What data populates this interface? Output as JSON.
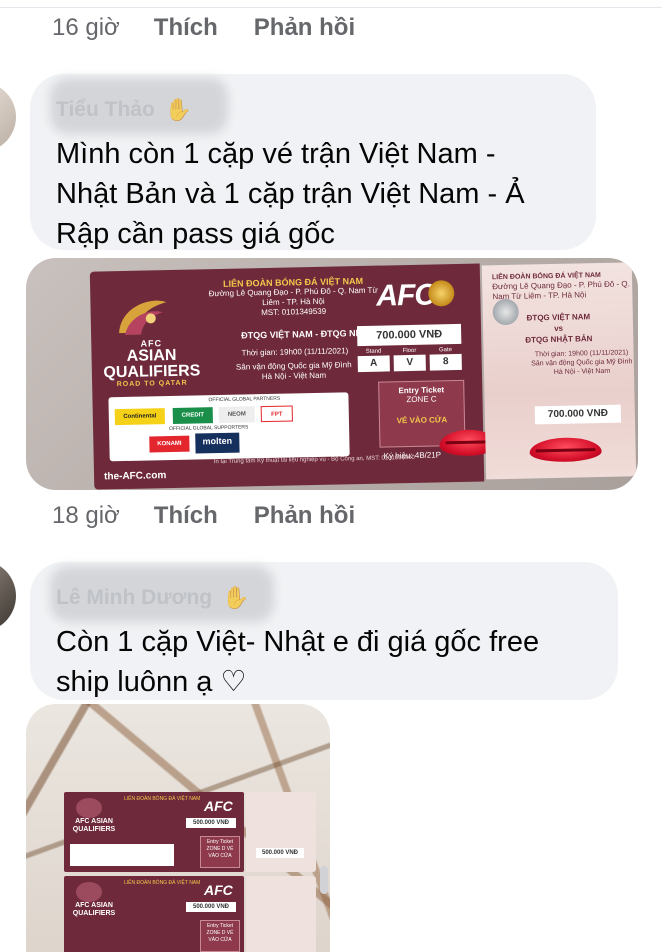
{
  "comment0": {
    "time": "16 giờ",
    "like": "Thích",
    "reply": "Phản hồi"
  },
  "comment1": {
    "author": "Tiểu Thảo",
    "text_line1": "Mình còn 1 cặp vé trận Việt Nam -",
    "text_line2": "Nhật Bản và 1 cặp trận Việt Nam - Ả",
    "text_line3": "Rập cần pass giá gốc",
    "wave_icon": "wave-hand-icon",
    "time": "18 giờ",
    "like": "Thích",
    "reply": "Phản hồi",
    "ticket": {
      "federation": "LIÊN ĐOÀN BÓNG ĐÁ VIỆT NAM",
      "address": "Đường Lê Quang Đạo - P. Phú Đô - Q. Nam Từ Liêm - TP. Hà Nội",
      "tax_code": "MST: 0101349539",
      "brand": "AFC",
      "afc_small": "AFC",
      "qualifiers_line1": "ASIAN",
      "qualifiers_line2": "QUALIFIERS",
      "road": "ROAD TO QATAR",
      "match": "ĐTQG VIỆT NAM - ĐTQG NHẬT BẢN",
      "date": "Thời gian: 19h00 (11/11/2021)",
      "venue": "Sân vận động Quốc gia Mỹ Đình Hà Nội - Việt Nam",
      "price": "700.000 VNĐ",
      "stand_label": "Stand",
      "floor_label": "Floor",
      "gate_label": "Gate",
      "stand": "A",
      "floor": "V",
      "gate": "8",
      "partners_label": "OFFICIAL GLOBAL PARTNERS",
      "supporters_label": "OFFICIAL GLOBAL SUPPORTERS",
      "sponsor1": "Continental",
      "sponsor2": "CREDIT SAISON",
      "sponsor3": "NEOM",
      "sponsor4": "FPT",
      "sponsor5": "KONAMI",
      "sponsor6": "molten",
      "entry": "Entry Ticket",
      "zone": "ZONE C",
      "gate_text": "VÉ VÀO CỬA",
      "serial": "Ký hiệu: 4B/21P",
      "url": "the-AFC.com",
      "legal": "In tại Trung tâm Kỹ thuật tài liệu nghiệp vụ - Bộ Công an, MST: 0101066060",
      "stub_match_1": "ĐTQG VIỆT NAM",
      "stub_vs": "vs",
      "stub_match_2": "ĐTQG NHẬT BẢN",
      "stub_date": "Thời gian: 19h00 (11/11/2021)",
      "stub_venue": "Sân vận động Quốc gia Mỹ Đình Hà Nội - Việt Nam",
      "stub_price": "700.000 VNĐ"
    }
  },
  "comment2": {
    "author": "Lê Minh Dương",
    "text_line1": "Còn 1 cặp Việt- Nhật e đi giá gốc free",
    "text_line2": "ship luônn ạ ♡",
    "wave_icon": "wave-hand-icon",
    "ticket_mini": {
      "brand": "AFC",
      "q1": "AFC ASIAN QUALIFIERS",
      "price1": "500.000 VNĐ",
      "price2": "500.000 VNĐ",
      "head": "LIÊN ĐOÀN BÓNG ĐÁ VIỆT NAM",
      "entry": "Entry Ticket ZONE D VÉ VÀO CỬA"
    }
  },
  "colors": {
    "bubble": "#f0f2f5",
    "meta_text": "#65676b",
    "ticket_maroon": "#6e2a3b"
  }
}
